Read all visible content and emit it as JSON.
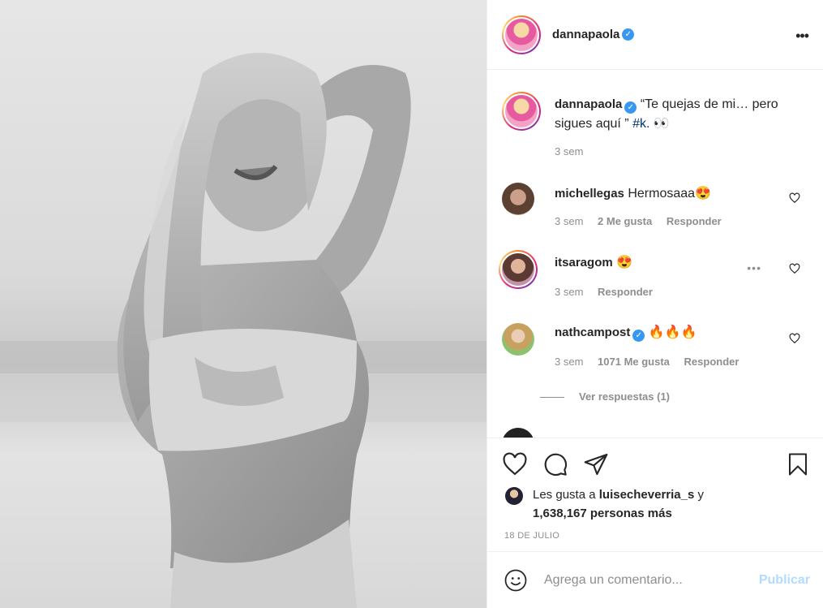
{
  "post": {
    "author": "dannapaola",
    "caption_text": "“Te quejas de mi… pero sigues aquí ” ",
    "caption_hashtag": "#k.",
    "caption_emoji": "👀",
    "caption_time": "3 sem"
  },
  "comments": [
    {
      "user": "michellegas",
      "text": "Hermosaaa😍",
      "time": "3 sem",
      "likes": "2 Me gusta",
      "reply": "Responder"
    },
    {
      "user": "itsaragom",
      "text": "😍",
      "time": "3 sem",
      "reply": "Responder"
    },
    {
      "user": "nathcampost",
      "text": "🔥🔥🔥",
      "time": "3 sem",
      "likes": "1071 Me gusta",
      "reply": "Responder",
      "view_replies": "Ver respuestas (1)"
    }
  ],
  "likes": {
    "prefix": "Les gusta a ",
    "user": "luisecheverria_s",
    "suffix": " y",
    "count": "1,638,167 personas más"
  },
  "date": "18 DE JULIO",
  "add_comment": {
    "placeholder": "Agrega un comentario...",
    "publish": "Publicar"
  },
  "icons": {
    "verified": "verified-badge-icon",
    "more": "more-options-icon",
    "like": "heart-icon",
    "comment": "comment-icon",
    "share": "share-icon",
    "save": "bookmark-icon",
    "emoji": "emoji-icon"
  },
  "colors": {
    "verified": "#3897f0",
    "hashtag": "#00376b",
    "publish": "#b3dbff",
    "muted": "#8e8e8e"
  }
}
